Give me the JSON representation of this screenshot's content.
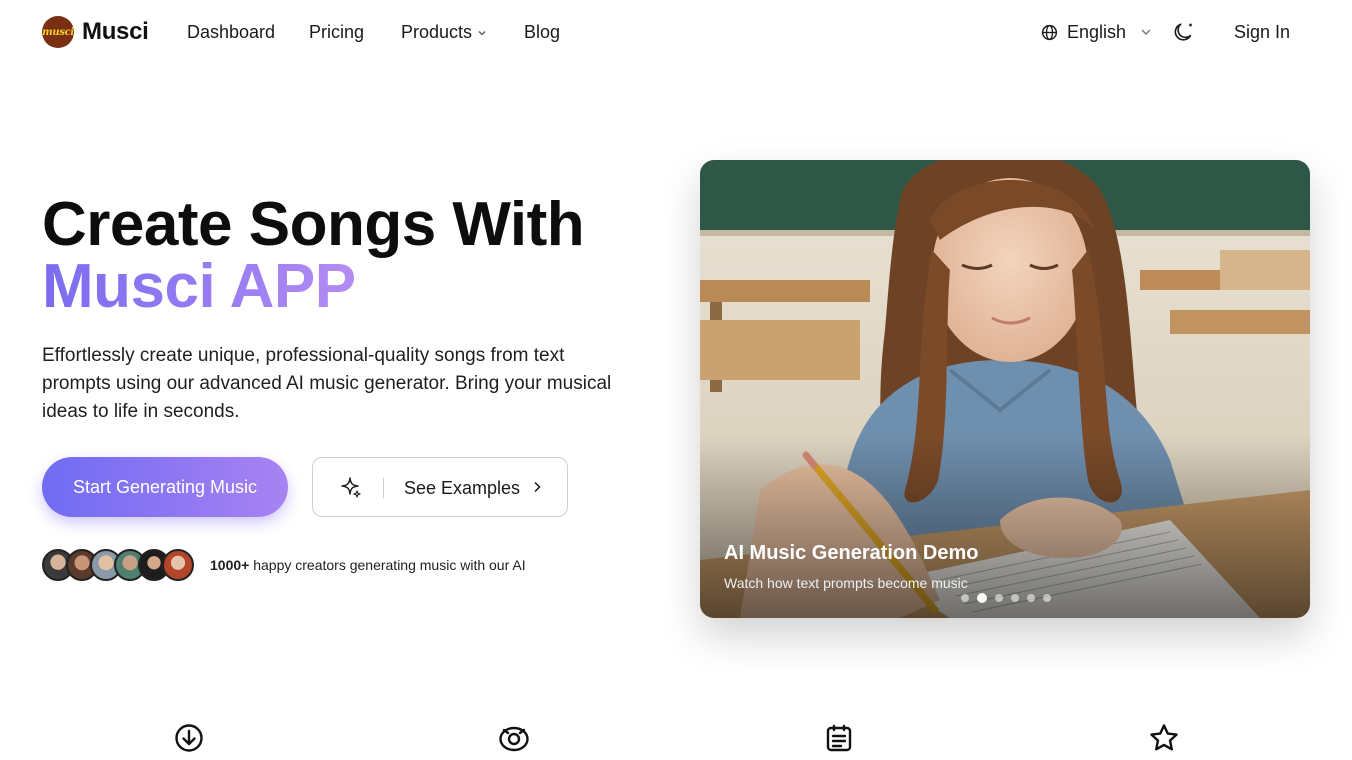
{
  "brand": {
    "name": "Musci",
    "logo_text": "musci"
  },
  "nav": {
    "links": [
      {
        "label": "Dashboard"
      },
      {
        "label": "Pricing"
      },
      {
        "label": "Products"
      },
      {
        "label": "Blog"
      }
    ],
    "language": "English",
    "theme_icon": "moon-icon",
    "sign_in": "Sign In"
  },
  "hero": {
    "title_line1": "Create Songs With",
    "title_line2": "Musci APP",
    "description": "Effortlessly create unique, professional-quality songs from text prompts using our advanced AI music generator. Bring your musical ideas to life in seconds.",
    "primary_button": "Start Generating Music",
    "secondary_button": "See Examples",
    "social_count": "1000+",
    "social_text": " happy creators generating music with our AI"
  },
  "demo_card": {
    "title": "AI Music Generation Demo",
    "subtitle": "Watch how text prompts become music",
    "slide_count": 6,
    "active_slide": 2
  },
  "features": {
    "icons": [
      "download-circle-icon",
      "eye-target-icon",
      "document-icon",
      "star-icon"
    ]
  },
  "colors": {
    "accent_start": "#6f6cf3",
    "accent_end": "#a883f2",
    "title_gradient_start": "#7b6cf0",
    "title_gradient_end": "#b48cf3"
  }
}
